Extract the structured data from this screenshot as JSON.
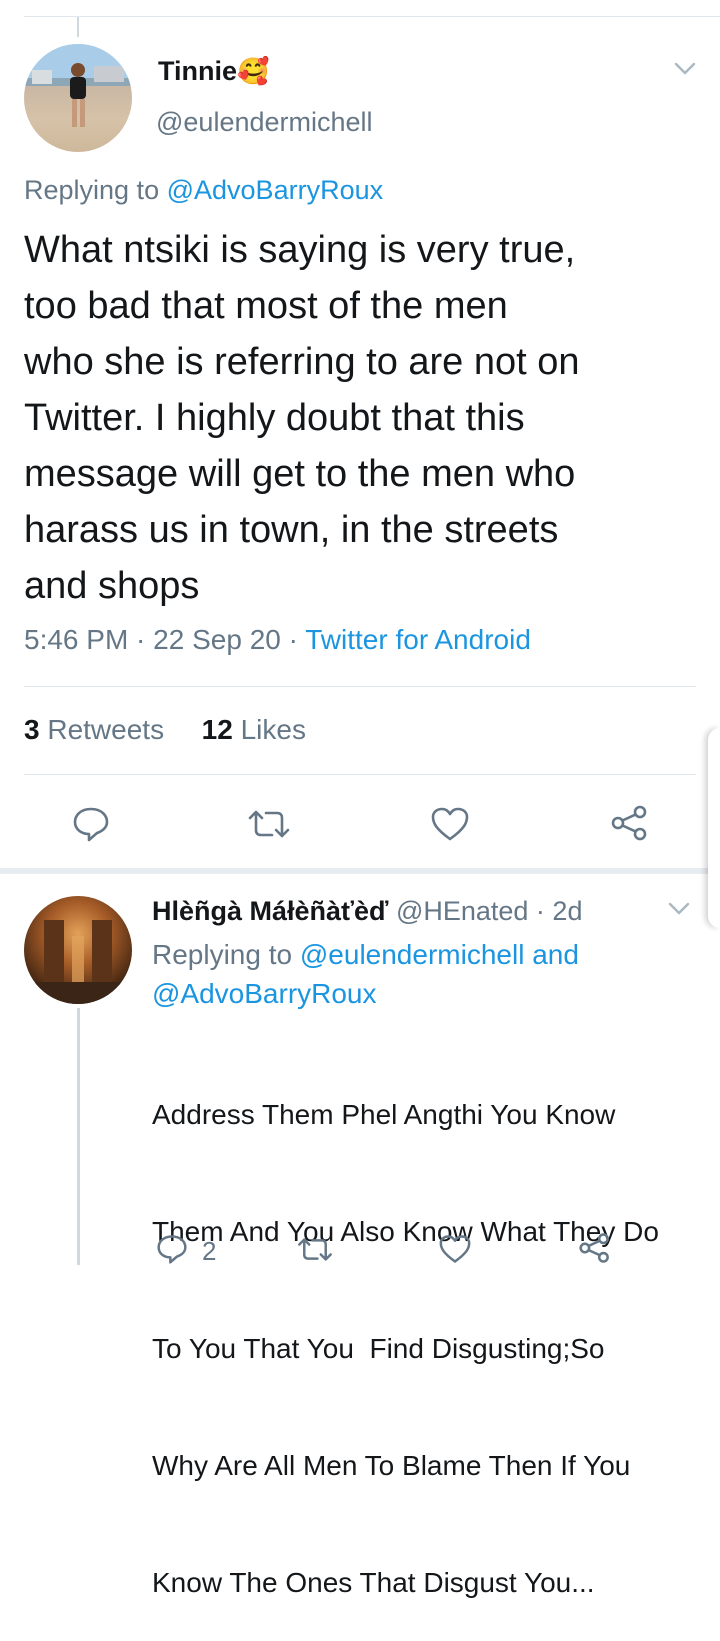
{
  "main_tweet": {
    "display_name": "Tinnie",
    "emoji": "🥰",
    "handle": "@eulendermichell",
    "replying_prefix": "Replying to",
    "replying_to": "@AdvoBarryRoux",
    "text_lines": [
      "What ntsiki is saying is very true,",
      "too bad that most of the men",
      "who she is referring to are not on",
      "Twitter. I highly doubt that this",
      "message will get to the men who",
      "harass us in town, in the streets",
      "and shops"
    ],
    "time": "5:46 PM",
    "date": "22 Sep 20",
    "client": "Twitter for Android",
    "retweet_count": "3",
    "retweet_label": "Retweets",
    "like_count": "12",
    "like_label": "Likes"
  },
  "reply_tweet": {
    "display_name": "Hlèñgà Máłèñàťèď",
    "handle": "@HEnated",
    "age": "2d",
    "replying_prefix": "Replying to",
    "replying_to_1": "@eulendermichell and",
    "replying_to_2": "@AdvoBarryRoux",
    "text_lines": [
      "Address Them Phel Angthi You Know",
      "Them And You Also Know What They Do",
      "To You That You  Find Disgusting;So",
      "Why Are All Men To Blame Then If You",
      "Know The Ones That Disgust You..."
    ],
    "reply_count": "2"
  },
  "icons": {
    "caret": "chevron-down-icon",
    "reply": "reply-bubble-icon",
    "retweet": "retweet-icon",
    "like": "heart-icon",
    "share": "share-icon"
  },
  "colors": {
    "link": "#1b95e0",
    "muted": "#657786",
    "text": "#14171a",
    "divider": "#e1e8ed"
  }
}
